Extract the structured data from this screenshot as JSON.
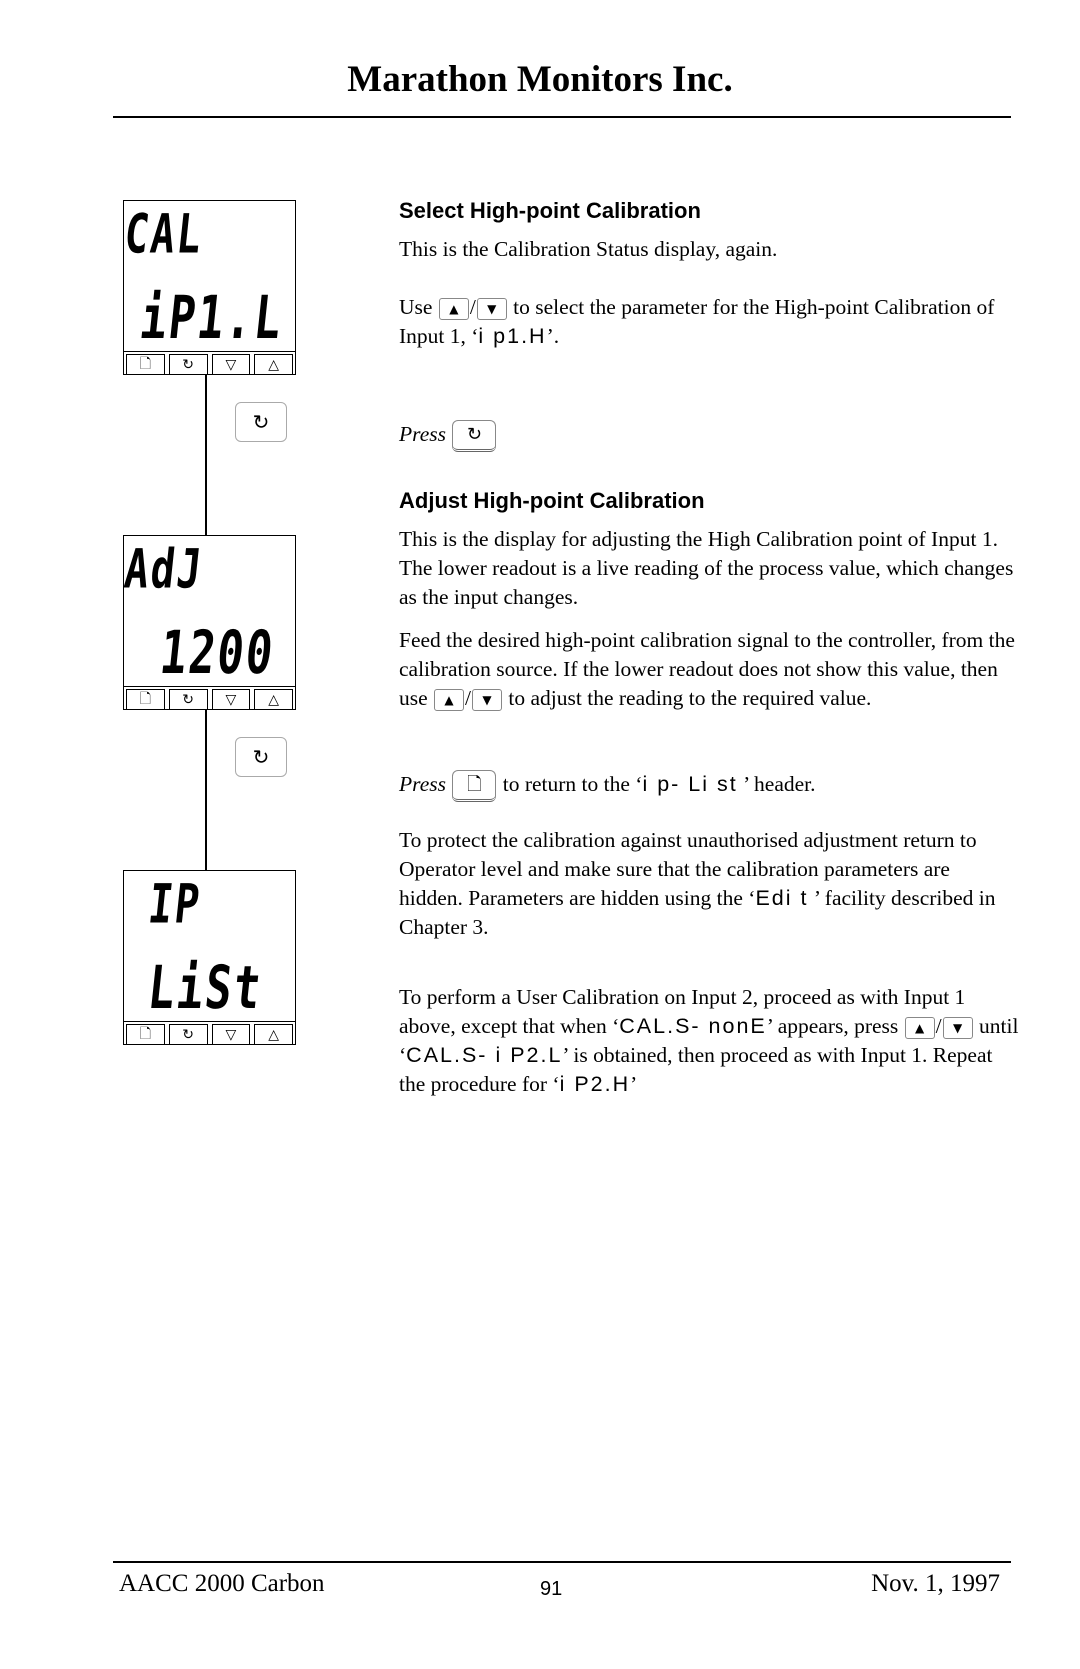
{
  "header": {
    "title": "Marathon Monitors Inc."
  },
  "panels": [
    {
      "top_readout": "CAL",
      "bottom_readout": "iP1.L",
      "keys": [
        "page-icon",
        "scroll-icon",
        "down-icon",
        "up-icon"
      ]
    },
    {
      "top_readout": "AdJ",
      "bottom_readout": "1200",
      "keys": [
        "page-icon",
        "scroll-icon",
        "down-icon",
        "up-icon"
      ]
    },
    {
      "top_readout": "IP",
      "bottom_readout": "LiSt",
      "keys": [
        "page-icon",
        "scroll-icon",
        "down-icon",
        "up-icon"
      ]
    }
  ],
  "key_glyphs": {
    "page": "🗋",
    "scroll": "↻",
    "down": "▽",
    "up": "△",
    "up_small": "▲",
    "down_small": "▼"
  },
  "section1": {
    "heading": "Select High-point Calibration",
    "p1": "This is the Calibration Status display, again.",
    "p2_a": "Use",
    "p2_sep": "/",
    "p2_b": "to select the parameter for the High-point Calibration of Input 1, ‘",
    "p2_code": "i p1.H",
    "p2_c": "’.",
    "press_label": "Press"
  },
  "section2": {
    "heading": "Adjust High-point Calibration",
    "p1": "This is the display for adjusting the High Calibration point of Input 1.   The lower readout is a live reading of the process value, which changes as the input changes.",
    "p2_a": "Feed the desired high-point calibration signal to the controller, from the calibration source.   If the lower readout does not show this value, then use",
    "p2_sep": "/",
    "p2_b": "to adjust the reading to the required value.",
    "press_label": "Press",
    "press_rest_a": "to return to the ‘",
    "press_code": "i p- Li st",
    "press_rest_b": " ’ header.",
    "p3_a": "To protect the calibration against unauthorised adjustment return to Operator level and make sure that the calibration parameters are hidden.   Parameters are hidden using the ‘",
    "p3_code": "Edi t",
    "p3_b": " ’ facility described in Chapter 3.",
    "p4_a": "To perform a User Calibration on Input 2, proceed as with Input 1 above, except that when ‘",
    "p4_code1": "CAL.S- nonE",
    "p4_b": "’ appears, press",
    "p4_sep": "/",
    "p4_c": "until ‘",
    "p4_code2": "CAL.S- i P2.L",
    "p4_d": "’ is obtained, then proceed as with Input 1.   Repeat the procedure for ‘",
    "p4_code3": "i P2.H",
    "p4_e": "’"
  },
  "footer": {
    "left": "AACC 2000 Carbon",
    "page_number": "91",
    "right": "Nov.  1, 1997"
  }
}
